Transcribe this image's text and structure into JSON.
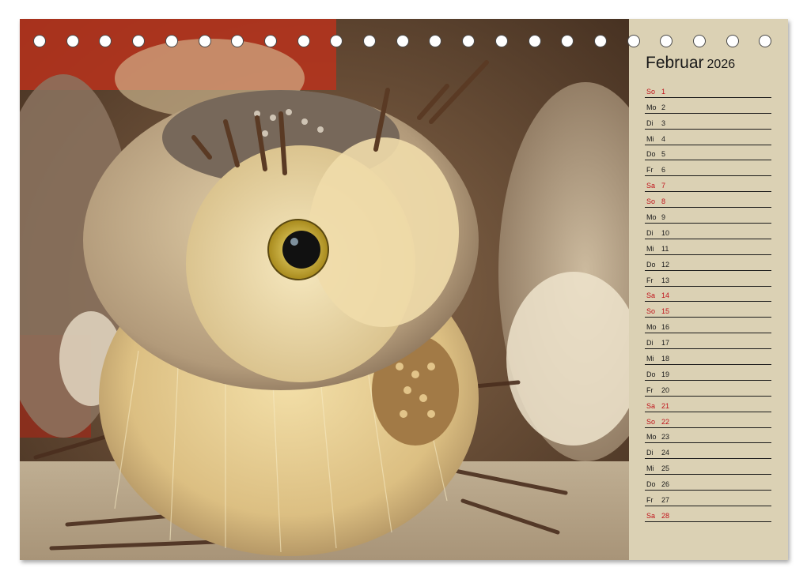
{
  "calendar": {
    "month": "Februar",
    "year": "2026",
    "days": [
      {
        "wd": "So",
        "d": "1",
        "weekend": true
      },
      {
        "wd": "Mo",
        "d": "2",
        "weekend": false
      },
      {
        "wd": "Di",
        "d": "3",
        "weekend": false
      },
      {
        "wd": "Mi",
        "d": "4",
        "weekend": false
      },
      {
        "wd": "Do",
        "d": "5",
        "weekend": false
      },
      {
        "wd": "Fr",
        "d": "6",
        "weekend": false
      },
      {
        "wd": "Sa",
        "d": "7",
        "weekend": true
      },
      {
        "wd": "So",
        "d": "8",
        "weekend": true
      },
      {
        "wd": "Mo",
        "d": "9",
        "weekend": false
      },
      {
        "wd": "Di",
        "d": "10",
        "weekend": false
      },
      {
        "wd": "Mi",
        "d": "11",
        "weekend": false
      },
      {
        "wd": "Do",
        "d": "12",
        "weekend": false
      },
      {
        "wd": "Fr",
        "d": "13",
        "weekend": false
      },
      {
        "wd": "Sa",
        "d": "14",
        "weekend": true
      },
      {
        "wd": "So",
        "d": "15",
        "weekend": true
      },
      {
        "wd": "Mo",
        "d": "16",
        "weekend": false
      },
      {
        "wd": "Di",
        "d": "17",
        "weekend": false
      },
      {
        "wd": "Mi",
        "d": "18",
        "weekend": false
      },
      {
        "wd": "Do",
        "d": "19",
        "weekend": false
      },
      {
        "wd": "Fr",
        "d": "20",
        "weekend": false
      },
      {
        "wd": "Sa",
        "d": "21",
        "weekend": true
      },
      {
        "wd": "So",
        "d": "22",
        "weekend": true
      },
      {
        "wd": "Mo",
        "d": "23",
        "weekend": false
      },
      {
        "wd": "Di",
        "d": "24",
        "weekend": false
      },
      {
        "wd": "Mi",
        "d": "25",
        "weekend": false
      },
      {
        "wd": "Do",
        "d": "26",
        "weekend": false
      },
      {
        "wd": "Fr",
        "d": "27",
        "weekend": false
      },
      {
        "wd": "Sa",
        "d": "28",
        "weekend": true
      }
    ]
  },
  "colors": {
    "panel": "#dbd1b4",
    "weekend_text": "#c0141c",
    "weekday_text": "#1a1a1a"
  },
  "photo": {
    "subject": "straw-owl-figure"
  }
}
